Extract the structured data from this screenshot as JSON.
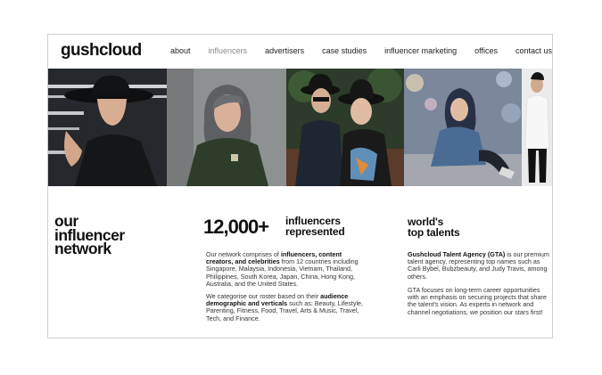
{
  "brand": {
    "logo_text": "gushcloud"
  },
  "nav": {
    "items": [
      {
        "label": "about"
      },
      {
        "label": "influencers",
        "active": true
      },
      {
        "label": "advertisers"
      },
      {
        "label": "case studies"
      },
      {
        "label": "influencer marketing"
      },
      {
        "label": "offices"
      },
      {
        "label": "contact us"
      }
    ]
  },
  "network": {
    "title_lines": [
      "our",
      "influencer",
      "network"
    ]
  },
  "stats": {
    "number": "12,000+",
    "label_lines": [
      "influencers",
      "represented"
    ],
    "p1": {
      "t1": "Our network comprises of ",
      "b1": "influencers, content creators, and celebrities",
      "t2": " from 12 countries including Singapore, Malaysia, Indonesia, Vietnam, Thailand, Philippines, South Korea, Japan, China, Hong Kong, Australia, and the United States."
    },
    "p2": {
      "t1": "We categorise our roster based on their ",
      "b1": "audience demographic and verticals",
      "t2": " such as: Beauty, Lifestyle, Parenting, Fitness, Food, Travel, Arts  & Music, Travel, Tech, and Finance."
    }
  },
  "talents": {
    "title_lines": [
      "world's",
      "top talents"
    ],
    "p1": {
      "b1": "Gushcloud Talent Agency (GTA)",
      "t1": " is our premium talent agency, representing top names such as Carli Bybel, Bubzbeauty, and Judy Travis, among others."
    },
    "p2": {
      "t1": "GTA focuses on long-term career opportunities with an emphasis on securing projects that share the talent's vision. As experts in network and channel negotiations, we position our stars first!"
    }
  },
  "colors": {
    "nav_active": "#8a8a8a",
    "text": "#111111",
    "frame_border": "#cfcfcf"
  }
}
